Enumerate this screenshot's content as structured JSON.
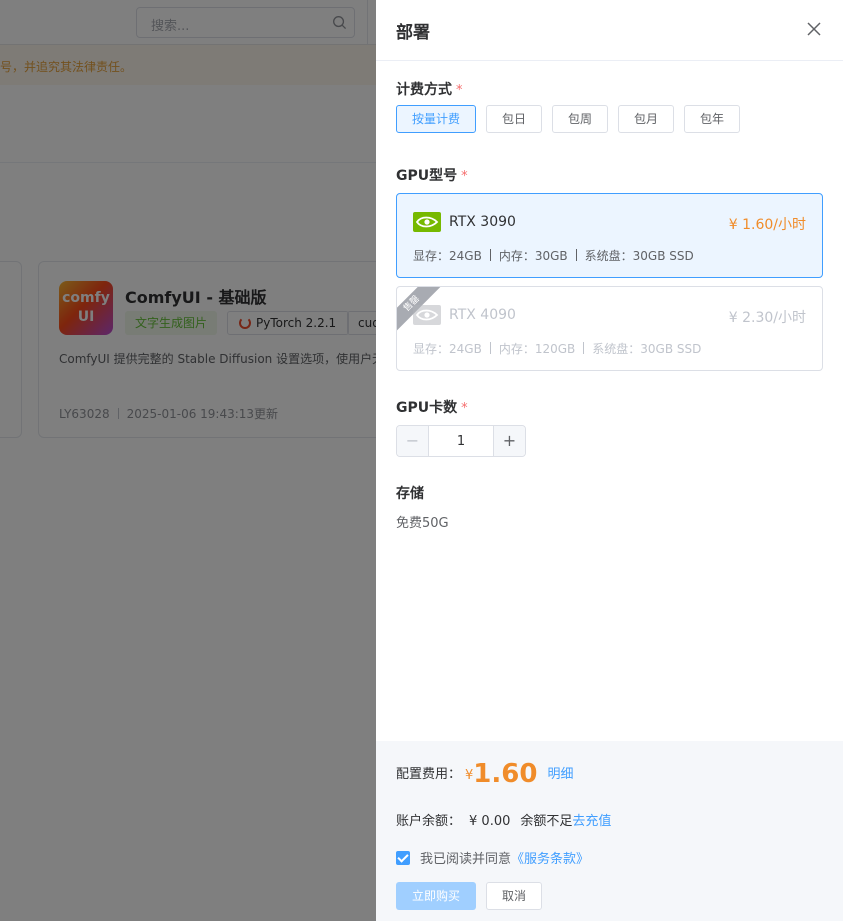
{
  "background": {
    "search_placeholder": "搜索...",
    "notice_text": "号，并追究其法律责任。",
    "card": {
      "logo_line1": "comfy",
      "logo_line2": "UI",
      "title": "ComfyUI - 基础版",
      "tag_category": "文字生成图片",
      "tag_framework": "PyTorch 2.2.1",
      "tag_cuda": "cuda",
      "description": "ComfyUI 提供完整的 Stable Diffusion 设置选项，使用户无需",
      "author": "LY63028",
      "updated": "2025-01-06 19:43:13更新"
    }
  },
  "drawer": {
    "title": "部署",
    "billing": {
      "label": "计费方式",
      "required": "*",
      "options": [
        "按量计费",
        "包日",
        "包周",
        "包月",
        "包年"
      ],
      "selected": "按量计费"
    },
    "gpu_model": {
      "label": "GPU型号",
      "required": "*",
      "items": [
        {
          "name": "RTX 3090",
          "price": "¥ 1.60/小时",
          "vram": "显存：24GB",
          "mem": "内存：30GB",
          "disk": "系统盘：30GB SSD",
          "selected": true,
          "available": true
        },
        {
          "name": "RTX 4090",
          "price": "¥ 2.30/小时",
          "vram": "显存：24GB",
          "mem": "内存：120GB",
          "disk": "系统盘：30GB SSD",
          "badge": "售罄",
          "selected": false,
          "available": false
        }
      ]
    },
    "gpu_count": {
      "label": "GPU卡数",
      "required": "*",
      "value": "1",
      "minus": "−",
      "plus": "+"
    },
    "storage": {
      "label": "存储",
      "value": "免费50G"
    },
    "footer": {
      "cost_label": "配置费用：",
      "currency": "¥",
      "cost_amount": "1.60",
      "detail_link": "明细",
      "balance_label": "账户余额：",
      "balance_value": "¥ 0.00",
      "insufficient_text": "余额不足",
      "recharge_link": "去充值",
      "agree_text": "我已阅读并同意",
      "terms_link": "《服务条款》",
      "agree_checked": true,
      "buy_label": "立即购买",
      "cancel_label": "取消"
    },
    "colors": {
      "primary": "#409eff",
      "price": "#f08c2a",
      "required": "#f56c6c",
      "nvidia": "#76b900"
    }
  }
}
